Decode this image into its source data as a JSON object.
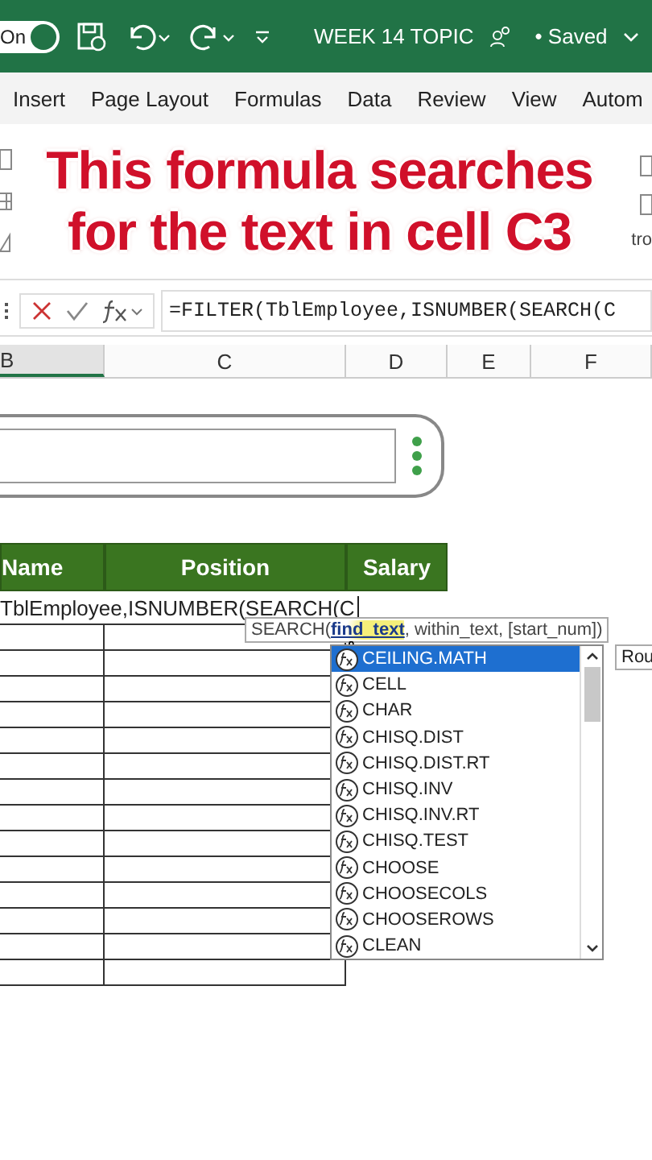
{
  "titlebar": {
    "autosave": "On",
    "title": "WEEK 14 TOPIC",
    "status": "• Saved"
  },
  "ribbon_tabs": [
    "Insert",
    "Page Layout",
    "Formulas",
    "Data",
    "Review",
    "View",
    "Autom"
  ],
  "caption": {
    "lines": [
      "This formula searches",
      "for the text in cell C3"
    ]
  },
  "ribbon_fragment": "tro",
  "formula_bar": {
    "formula": "=FILTER(TblEmployee,ISNUMBER(SEARCH(C"
  },
  "columns": [
    {
      "label": "B",
      "selected": true
    },
    {
      "label": "C",
      "selected": false
    },
    {
      "label": "D",
      "selected": false
    },
    {
      "label": "E",
      "selected": false
    },
    {
      "label": "F",
      "selected": false
    }
  ],
  "table": {
    "headers": [
      "Name",
      "Position",
      "Salary"
    ],
    "editing_cell": "TblEmployee,ISNUMBER(SEARCH(C"
  },
  "tooltip": {
    "function": "SEARCH(",
    "current_arg": "find_text",
    "rest": ", within_text, [start_num])"
  },
  "autocomplete": {
    "items": [
      {
        "label": "CEILING.MATH",
        "selected": true
      },
      {
        "label": "CELL",
        "selected": false
      },
      {
        "label": "CHAR",
        "selected": false
      },
      {
        "label": "CHISQ.DIST",
        "selected": false
      },
      {
        "label": "CHISQ.DIST.RT",
        "selected": false
      },
      {
        "label": "CHISQ.INV",
        "selected": false
      },
      {
        "label": "CHISQ.INV.RT",
        "selected": false
      },
      {
        "label": "CHISQ.TEST",
        "selected": false
      },
      {
        "label": "CHOOSE",
        "selected": false
      },
      {
        "label": "CHOOSECOLS",
        "selected": false
      },
      {
        "label": "CHOOSEROWS",
        "selected": false
      },
      {
        "label": "CLEAN",
        "selected": false
      }
    ],
    "side_tip": "Rou"
  }
}
